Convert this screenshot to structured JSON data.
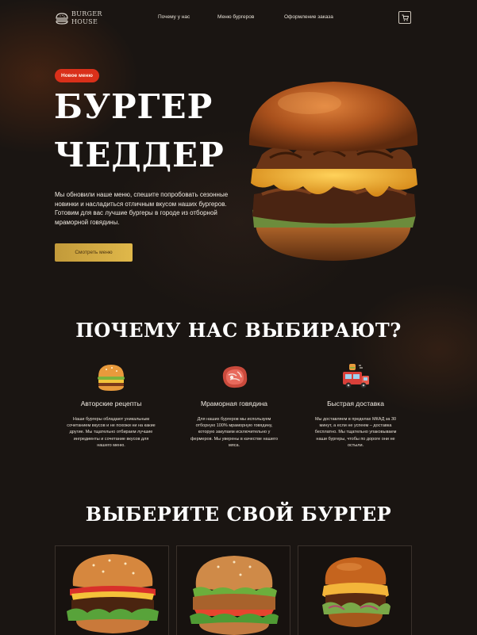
{
  "header": {
    "logo_line1": "BURGER",
    "logo_line2": "HOUSE",
    "nav": [
      "Почему у нас",
      "Меню бургеров",
      "Оформление заказа"
    ],
    "cart_icon": "cart-icon"
  },
  "hero": {
    "badge": "Новое меню",
    "title_line1": "БУРГЕР",
    "title_line2": "ЧЕДДЕР",
    "text": "Мы обновили наше меню, спешите попробовать сезонные новинки и насладиться отличным вкусом наших бургеров. Готовим для вас лучшие бургеры в городе из отборной мраморной говядины.",
    "button": "Смотреть меню"
  },
  "why": {
    "title": "ПОЧЕМУ НАС ВЫБИРАЮТ?",
    "features": [
      {
        "icon": "burger-icon",
        "title": "Авторские рецепты",
        "text": "Наши бургеры обладают уникальным сочетанием вкусов и не похожи ни на какие другие. Мы тщательно отбираем лучшие ингредиенты и сочетание вкусов для нашего меню."
      },
      {
        "icon": "meat-icon",
        "title": "Мраморная говядина",
        "text": "Для наших бургеров мы используем отборную 100% мраморную говядину, которую закупаем исключительно у фермеров. Мы уверены в качестве нашего мяса."
      },
      {
        "icon": "delivery-truck-icon",
        "title": "Быстрая доставка",
        "text": "Мы доставляем в пределах МКАД за 30 минут, а если не успеем – доставка бесплатно. Мы тщательно упаковываем наши бургеры, чтобы по дороге они не остыли."
      }
    ]
  },
  "menu": {
    "title": "ВЫБЕРИТЕ СВОЙ БУРГЕР"
  },
  "colors": {
    "background": "#1a1512",
    "badge": "#d9301a",
    "button_gold": "#d4ac45"
  }
}
